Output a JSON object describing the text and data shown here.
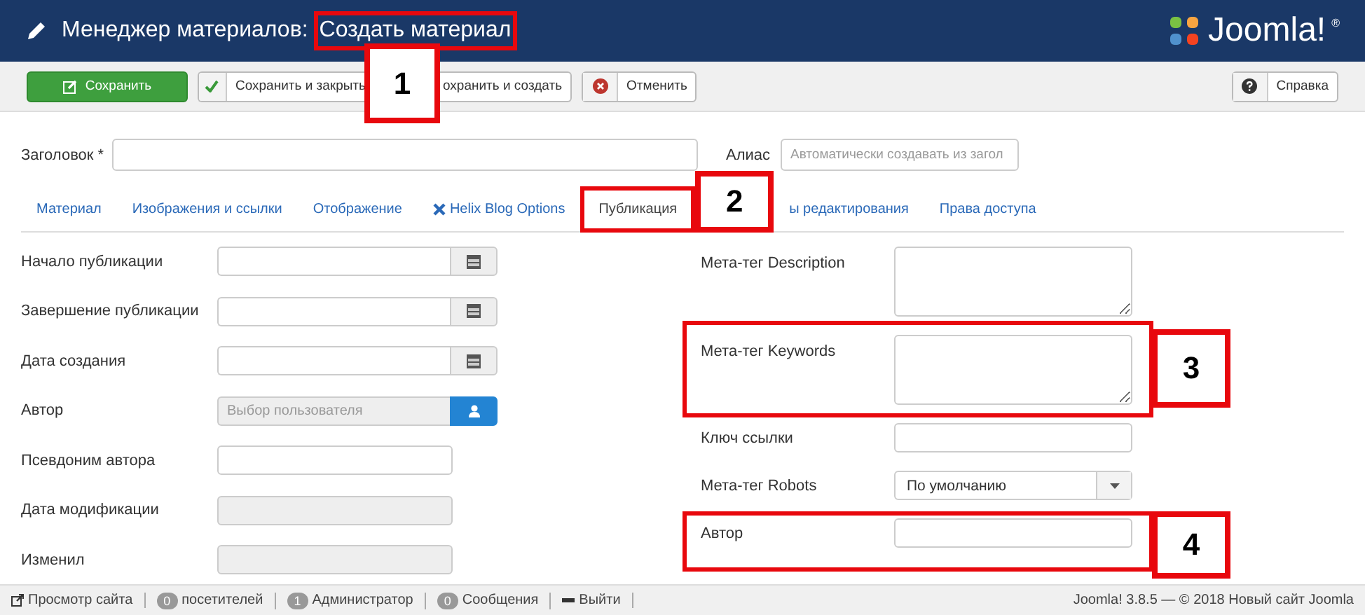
{
  "header": {
    "title": "Менеджер материалов:",
    "subtitle": "Создать материал",
    "callout": "1",
    "logo": {
      "text": "Joomla!",
      "mark": "®"
    }
  },
  "toolbar": {
    "buttons": [
      {
        "label": "Сохранить",
        "kind": "save"
      },
      {
        "label": "Сохранить и закрыть",
        "kind": "apply"
      },
      {
        "label": "охранить и создать",
        "kind": "new"
      },
      {
        "label": "Отменить",
        "kind": "cancel"
      },
      {
        "label": "Справка",
        "kind": "help"
      }
    ]
  },
  "title_field": {
    "label": "Заголовок *"
  },
  "alias_field": {
    "label": "Алиас",
    "placeholder": "Автоматически создавать из загол"
  },
  "tabs": [
    {
      "label": "Материал",
      "selected": false
    },
    {
      "label": "Изображения и ссылки",
      "selected": false
    },
    {
      "label": "Отображение",
      "selected": false
    },
    {
      "label": "Helix Blog Options",
      "selected": false,
      "kind": "helix"
    },
    {
      "label": "Публикация",
      "selected": true,
      "callout": "2"
    },
    {
      "label": "ы редактирования",
      "selected": false
    },
    {
      "label": "Права доступа",
      "selected": false
    }
  ],
  "left_fields": [
    {
      "label": "Начало публикации",
      "kind": "date"
    },
    {
      "label": "Завершение публикации",
      "kind": "date"
    },
    {
      "label": "Дата создания",
      "kind": "date"
    },
    {
      "label": "Автор",
      "kind": "user",
      "placeholder": "Выбор пользователя"
    },
    {
      "label": "Псевдоним автора",
      "kind": "text"
    },
    {
      "label": "Дата модификации",
      "kind": "readonly"
    },
    {
      "label": "Изменил",
      "kind": "readonly"
    }
  ],
  "right_fields": [
    {
      "label": "Мета-тег Description",
      "kind": "textarea"
    },
    {
      "label": "Мета-тег Keywords",
      "kind": "textarea"
    },
    {
      "label": "Ключ ссылки",
      "kind": "text"
    },
    {
      "label": "Мета-тег Robots",
      "kind": "select",
      "value": "По умолчанию"
    },
    {
      "label": "Автор",
      "kind": "text"
    }
  ],
  "status_bar": {
    "items": [
      {
        "label": "Просмотр сайта",
        "kind": "link"
      },
      {
        "label": "посетителей",
        "badge": "0",
        "kind": "badge"
      },
      {
        "label": "Администратор",
        "badge": "1",
        "kind": "badge"
      },
      {
        "label": "Сообщения",
        "badge": "0",
        "kind": "badge"
      },
      {
        "label": "Выйти",
        "kind": "logout"
      }
    ],
    "version": "Joomla! 3.8.5 — © 2018 Новый сайт Joomla"
  },
  "annotations": [
    {
      "number": "3"
    },
    {
      "number": "4"
    }
  ]
}
